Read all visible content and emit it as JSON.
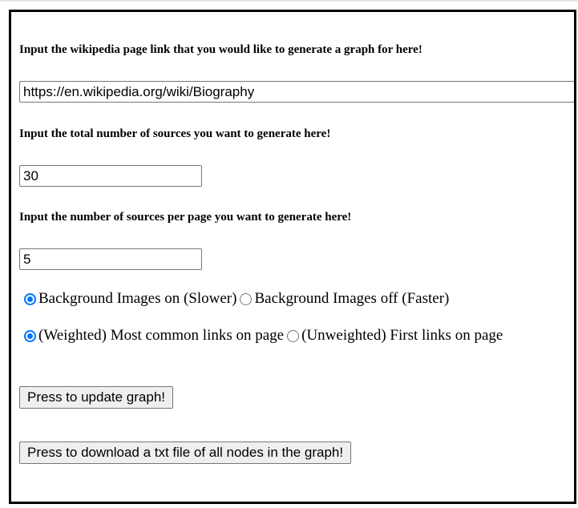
{
  "form": {
    "link_label": "Input the wikipedia page link that you would like to generate a graph for here!",
    "link_value": "https://en.wikipedia.org/wiki/Biography",
    "total_label": "Input the total number of sources you want to generate here!",
    "total_value": "30",
    "per_page_label": "Input the number of sources per page you want to generate here!",
    "per_page_value": "5"
  },
  "bg_images": {
    "on_label": "Background Images on (Slower)",
    "off_label": "Background Images off (Faster)",
    "selected": "on"
  },
  "link_mode": {
    "weighted_label": "(Weighted) Most common links on page",
    "unweighted_label": "(Unweighted) First links on page",
    "selected": "weighted"
  },
  "buttons": {
    "update_label": "Press to update graph!",
    "download_label": "Press to download a txt file of all nodes in the graph!"
  },
  "colors": {
    "radio_accent": "#0075ff",
    "button_bg": "#efefef",
    "frame_border": "#000000"
  }
}
